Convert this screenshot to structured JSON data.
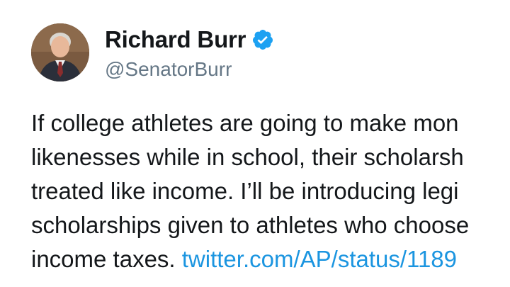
{
  "author": {
    "display_name": "Richard Burr",
    "handle": "@SenatorBurr",
    "verified_icon": "verified-badge-icon",
    "verified_color": "#1da1f2"
  },
  "tweet": {
    "lines": [
      "If college athletes are going to make mon",
      "likenesses while in school, their scholarsh",
      "treated like income. I’ll be introducing legi",
      "scholarships given to athletes who choose",
      "income taxes. "
    ],
    "link_text": "twitter.com/AP/status/1189",
    "link_color": "#1b95e0"
  }
}
